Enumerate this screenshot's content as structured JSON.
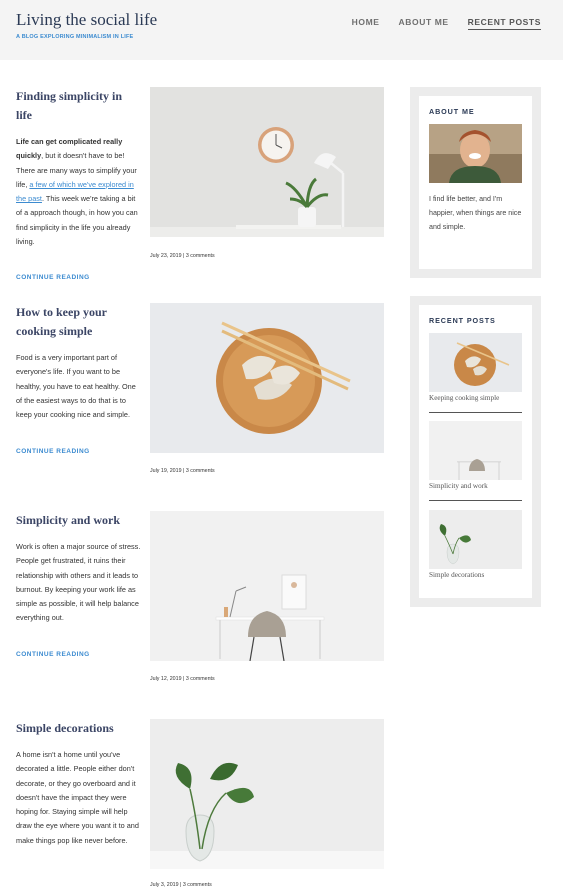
{
  "header": {
    "site_title": "Living the social life",
    "tagline": "A BLOG EXPLORING MINIMALISM IN LIFE",
    "nav": [
      {
        "label": "HOME"
      },
      {
        "label": "ABOUT ME"
      },
      {
        "label": "RECENT POSTS"
      }
    ]
  },
  "posts": [
    {
      "title": "Finding simplicity in life",
      "excerpt_bold": "Life can get complicated really quickly",
      "excerpt_part1": ", but it doesn't have to be! There are many ways to simplify your life, ",
      "excerpt_link": "a few of which we've explored in the past",
      "excerpt_part2": ". This week we're taking a bit of a approach though, in how you can find simplicity in the life you already living.",
      "continue": "CONTINUE READING",
      "meta": "July 23, 2019 | 3 comments",
      "image": "room-clock-lamp-image"
    },
    {
      "title": "How to keep your cooking simple",
      "excerpt": "Food is a very important part of everyone's life. If you want to be healthy, you have to eat healthy. One of the easiest ways to do that is to keep your cooking nice and simple.",
      "continue": "CONTINUE READING",
      "meta": "July 19, 2019 | 3 comments",
      "image": "dumplings-plate-image"
    },
    {
      "title": "Simplicity and work",
      "excerpt": "Work is often a major source of stress. People get frustrated, it ruins their relationship with others and it leads to burnout. By keeping your work life as simple as possible, it will help balance everything out.",
      "continue": "CONTINUE READING",
      "meta": "July 12, 2019 | 3 comments",
      "image": "desk-chair-image"
    },
    {
      "title": "Simple decorations",
      "excerpt": "A home isn't a home until you've decorated a little. People either don't decorate, or they go overboard and it doesn't have the impact they were hoping for. Staying simple will help draw the eye where you want it to and make things pop like never before.",
      "meta": "July 3, 2019 | 3 comments",
      "image": "plant-vase-image"
    }
  ],
  "sidebar": {
    "about": {
      "title": "ABOUT ME",
      "text": "I find life better, and I'm happier, when things are nice and simple.",
      "image": "smiling-person-photo"
    },
    "recent": {
      "title": "RECENT POSTS",
      "items": [
        {
          "label": "Keeping cooking simple"
        },
        {
          "label": "Simplicity and work"
        },
        {
          "label": "Simple decorations"
        }
      ]
    }
  },
  "colors": {
    "accent": "#3c8bd0",
    "title": "#2b3a55",
    "header_bg": "#f4f4f4",
    "widget_bg": "#ececec"
  }
}
